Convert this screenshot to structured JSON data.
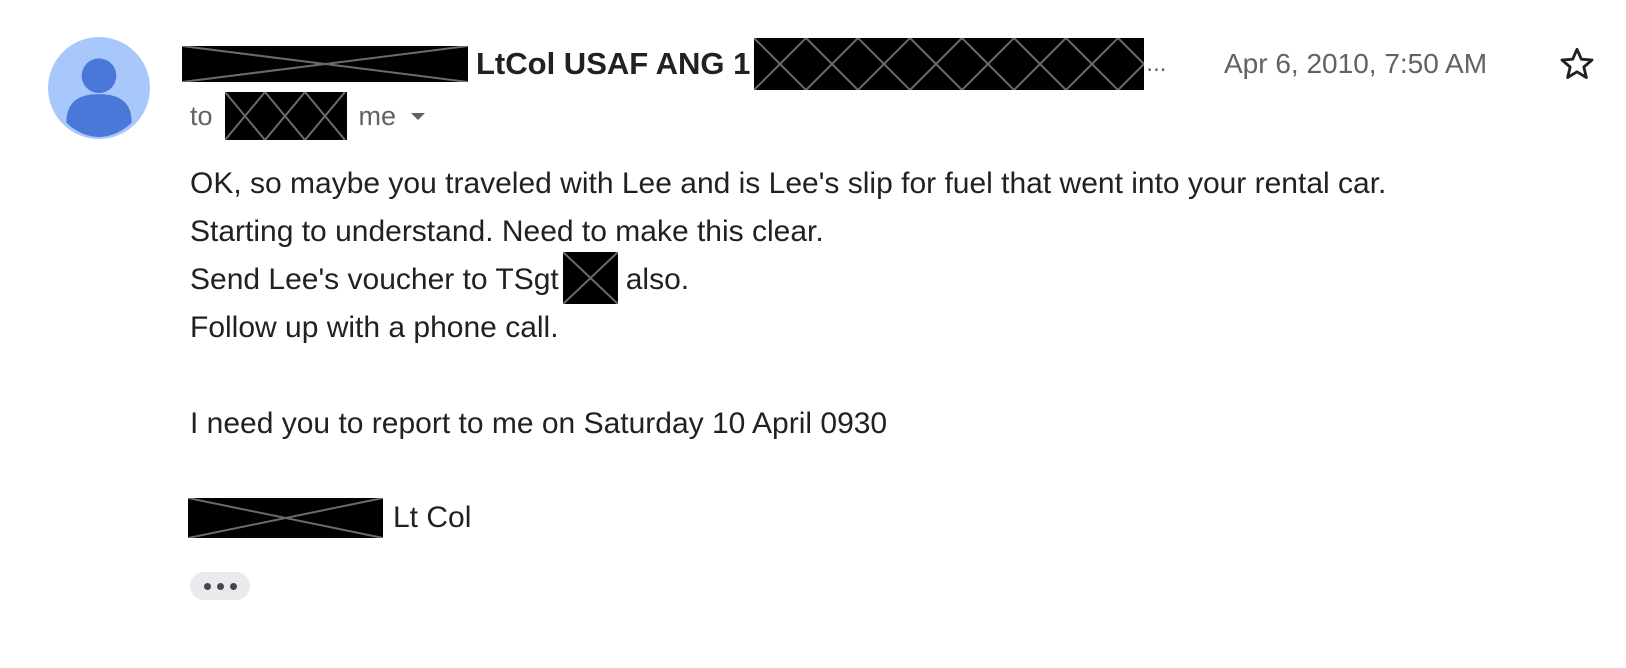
{
  "message": {
    "sender_visible": "LtCol USAF ANG 1",
    "sender_ellipsis": "...",
    "date": "Apr 6, 2010, 7:50 AM",
    "to_label": "to",
    "to_me": "me",
    "body_lines": [
      "OK, so maybe you traveled with Lee and is Lee's slip for fuel that went into your rental car.",
      "Starting to understand. Need to make this clear.",
      "Send Lee's voucher to TSgt",
      "also.",
      "Follow up with a phone call.",
      "I need you to report to me on Saturday 10 April 0930"
    ],
    "signature": "Lt Col"
  },
  "icons": {
    "avatar": "default-avatar-icon",
    "star": "star-outline-icon",
    "details": "caret-down-icon",
    "more": "ellipsis-icon"
  },
  "colors": {
    "avatar_bg": "#a8c7fa",
    "avatar_fg": "#4a78d8",
    "text": "#202124",
    "muted": "#5f6368",
    "redaction": "#000000"
  }
}
